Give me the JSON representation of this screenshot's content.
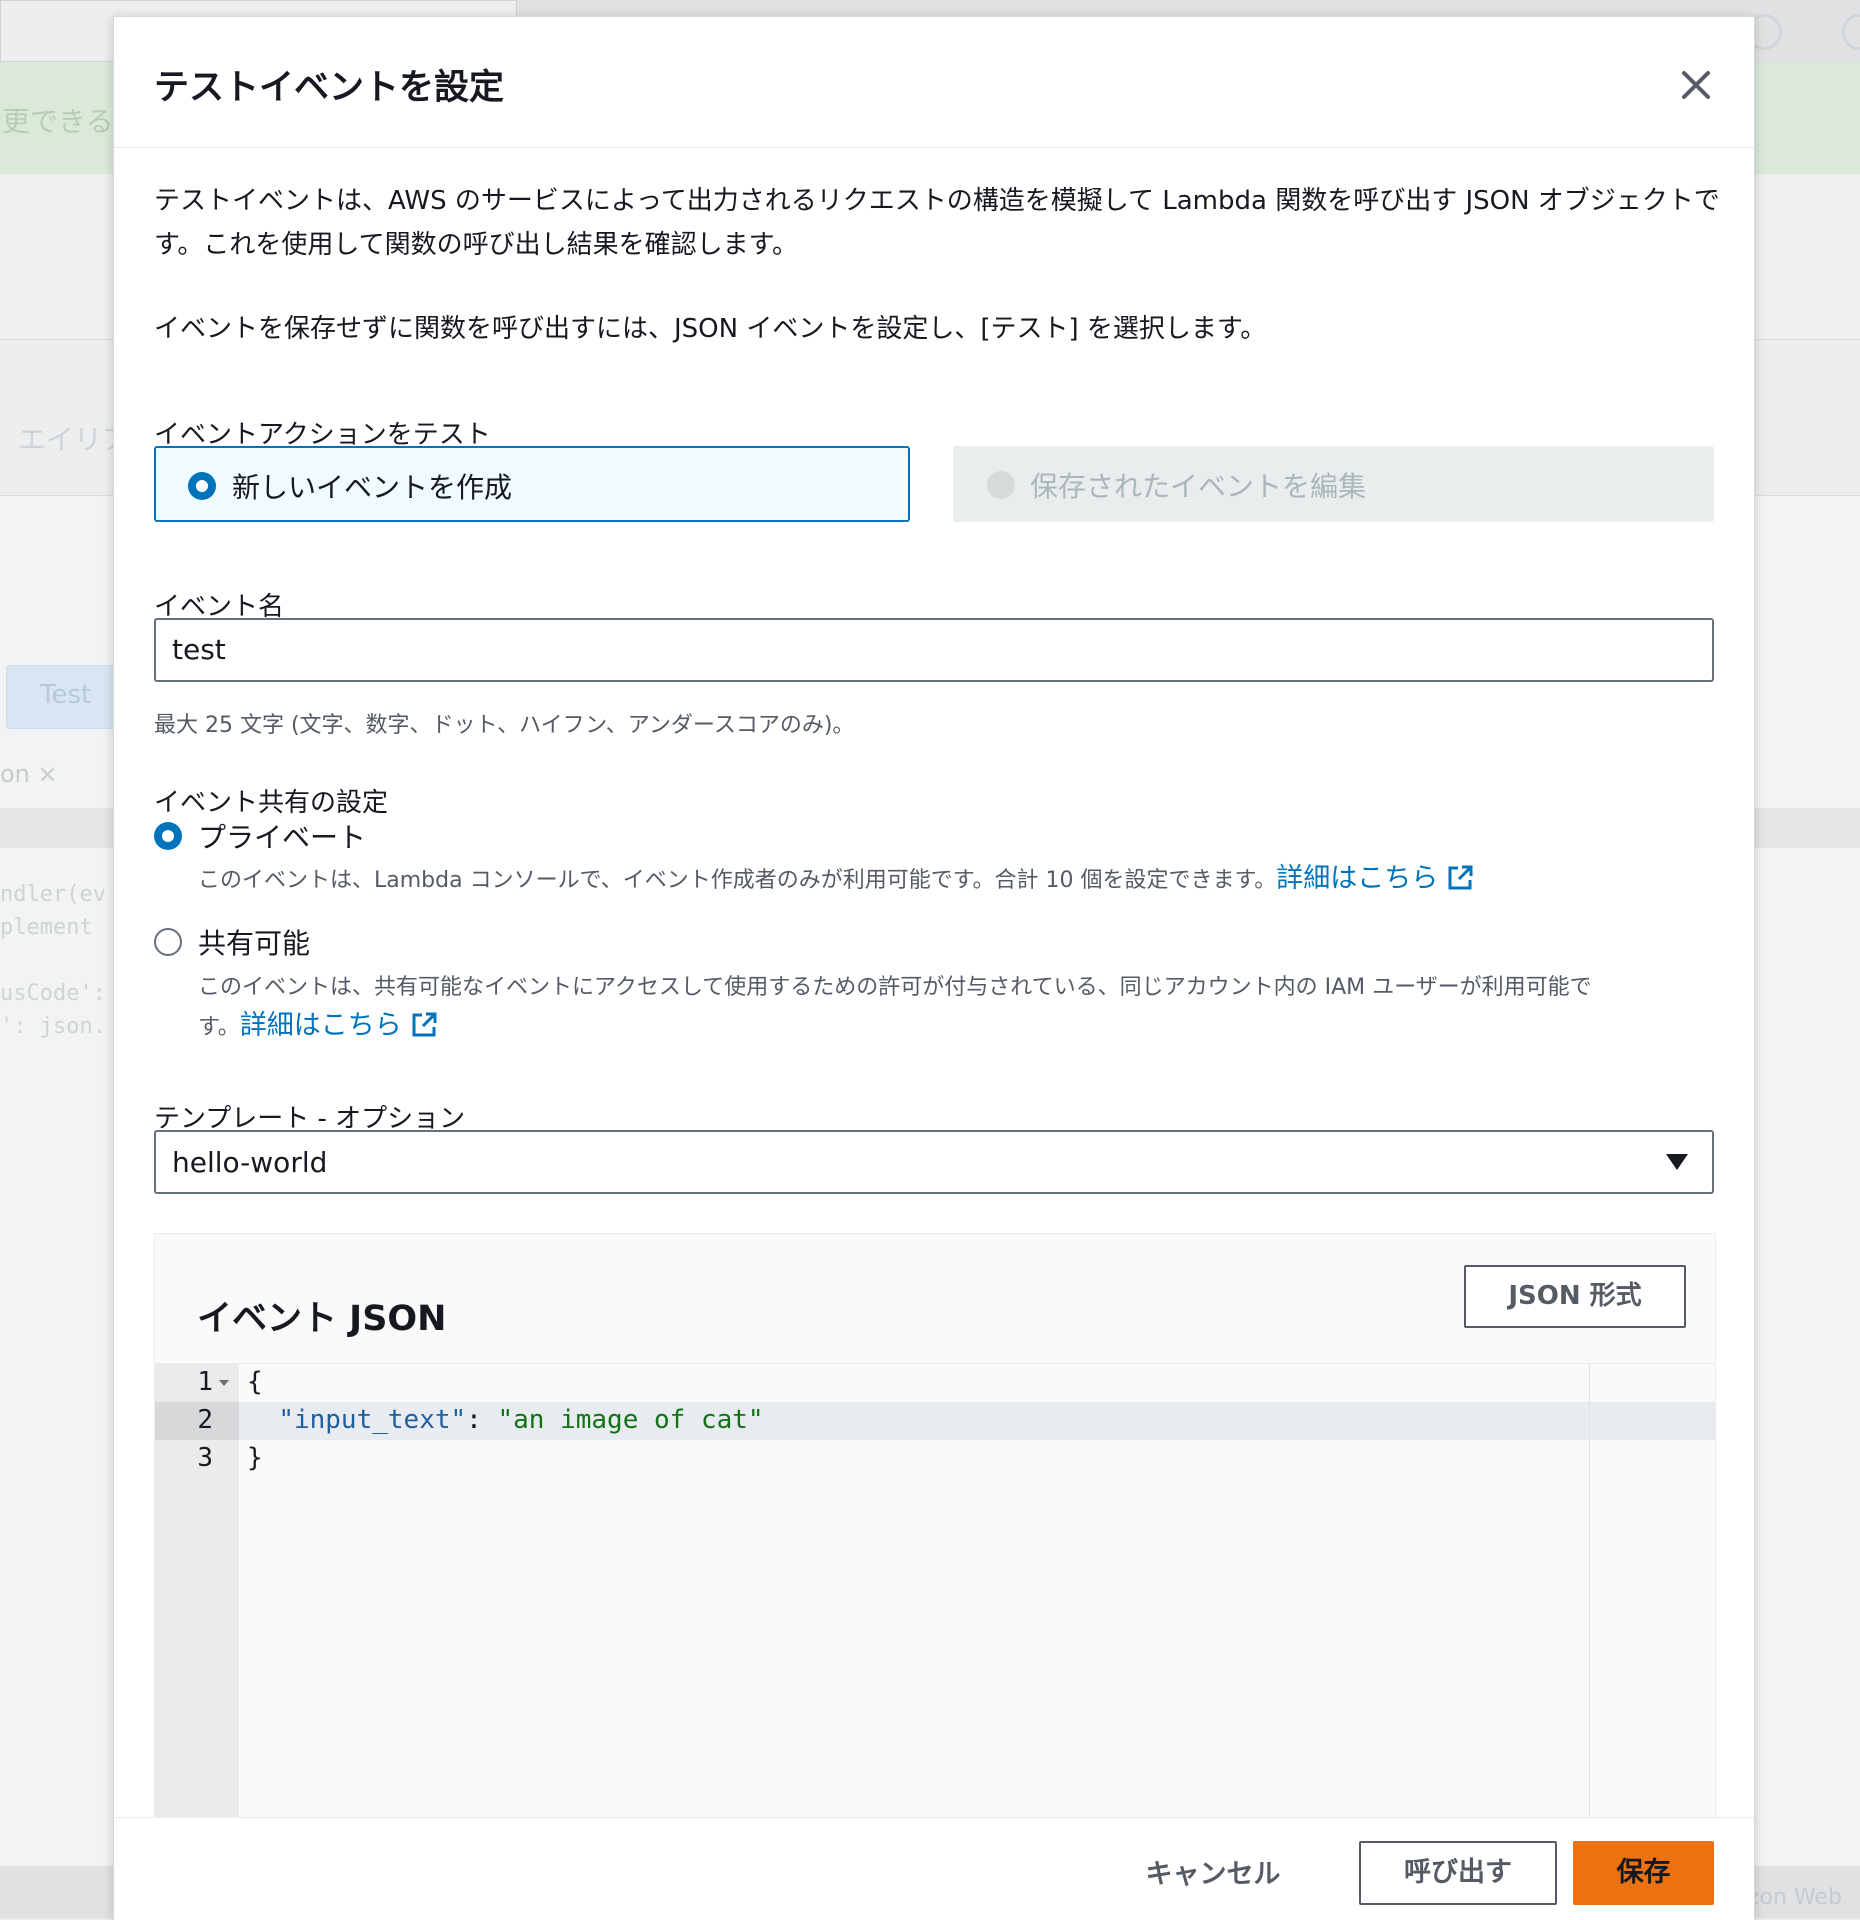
{
  "background": {
    "banner_fragment": "更できる",
    "alias_fragment": "エイリア",
    "test_button": "Test",
    "tab_fragment": "on",
    "code_lines": [
      "ndler(ev",
      "plement",
      "",
      "usCode':",
      "': json."
    ],
    "footer_fragment": "zon Web"
  },
  "modal": {
    "title": "テストイベントを設定",
    "intro": "テストイベントは、AWS のサービスによって出力されるリクエストの構造を模擬して Lambda 関数を呼び出す JSON オブジェクトです。これを使用して関数の呼び出し結果を確認します。",
    "intro2": "イベントを保存せずに関数を呼び出すには、JSON イベントを設定し、[テスト] を選択します。",
    "event_action": {
      "label": "イベントアクションをテスト",
      "options": [
        {
          "label": "新しいイベントを作成",
          "selected": true,
          "disabled": false
        },
        {
          "label": "保存されたイベントを編集",
          "selected": false,
          "disabled": true
        }
      ]
    },
    "event_name": {
      "label": "イベント名",
      "value": "test",
      "hint": "最大 25 文字 (文字、数字、ドット、ハイフン、アンダースコアのみ)。"
    },
    "sharing": {
      "label": "イベント共有の設定",
      "private": {
        "label": "プライベート",
        "desc": "このイベントは、Lambda コンソールで、イベント作成者のみが利用可能です。合計 10 個を設定できます。",
        "link": "詳細はこちら",
        "selected": true
      },
      "shareable": {
        "label": "共有可能",
        "desc1": "このイベントは、共有可能なイベントにアクセスして使用するための許可が付与されている、同じアカウント内の IAM ユーザーが利用可能で",
        "desc2": "す。",
        "link": "詳細はこちら",
        "selected": false
      }
    },
    "template": {
      "label": "テンプレート - オプション",
      "value": "hello-world"
    },
    "event_json": {
      "title": "イベント JSON",
      "format_button": "JSON 形式",
      "line_numbers": [
        "1",
        "2",
        "3"
      ],
      "line1": "{",
      "key": "\"input_text\"",
      "colon": ": ",
      "value": "\"an image of cat\"",
      "line3": "}"
    },
    "footer": {
      "cancel": "キャンセル",
      "invoke": "呼び出す",
      "save": "保存"
    }
  },
  "colors": {
    "primary": "#0073bb",
    "save_button": "#ec7211",
    "border": "#687078"
  }
}
